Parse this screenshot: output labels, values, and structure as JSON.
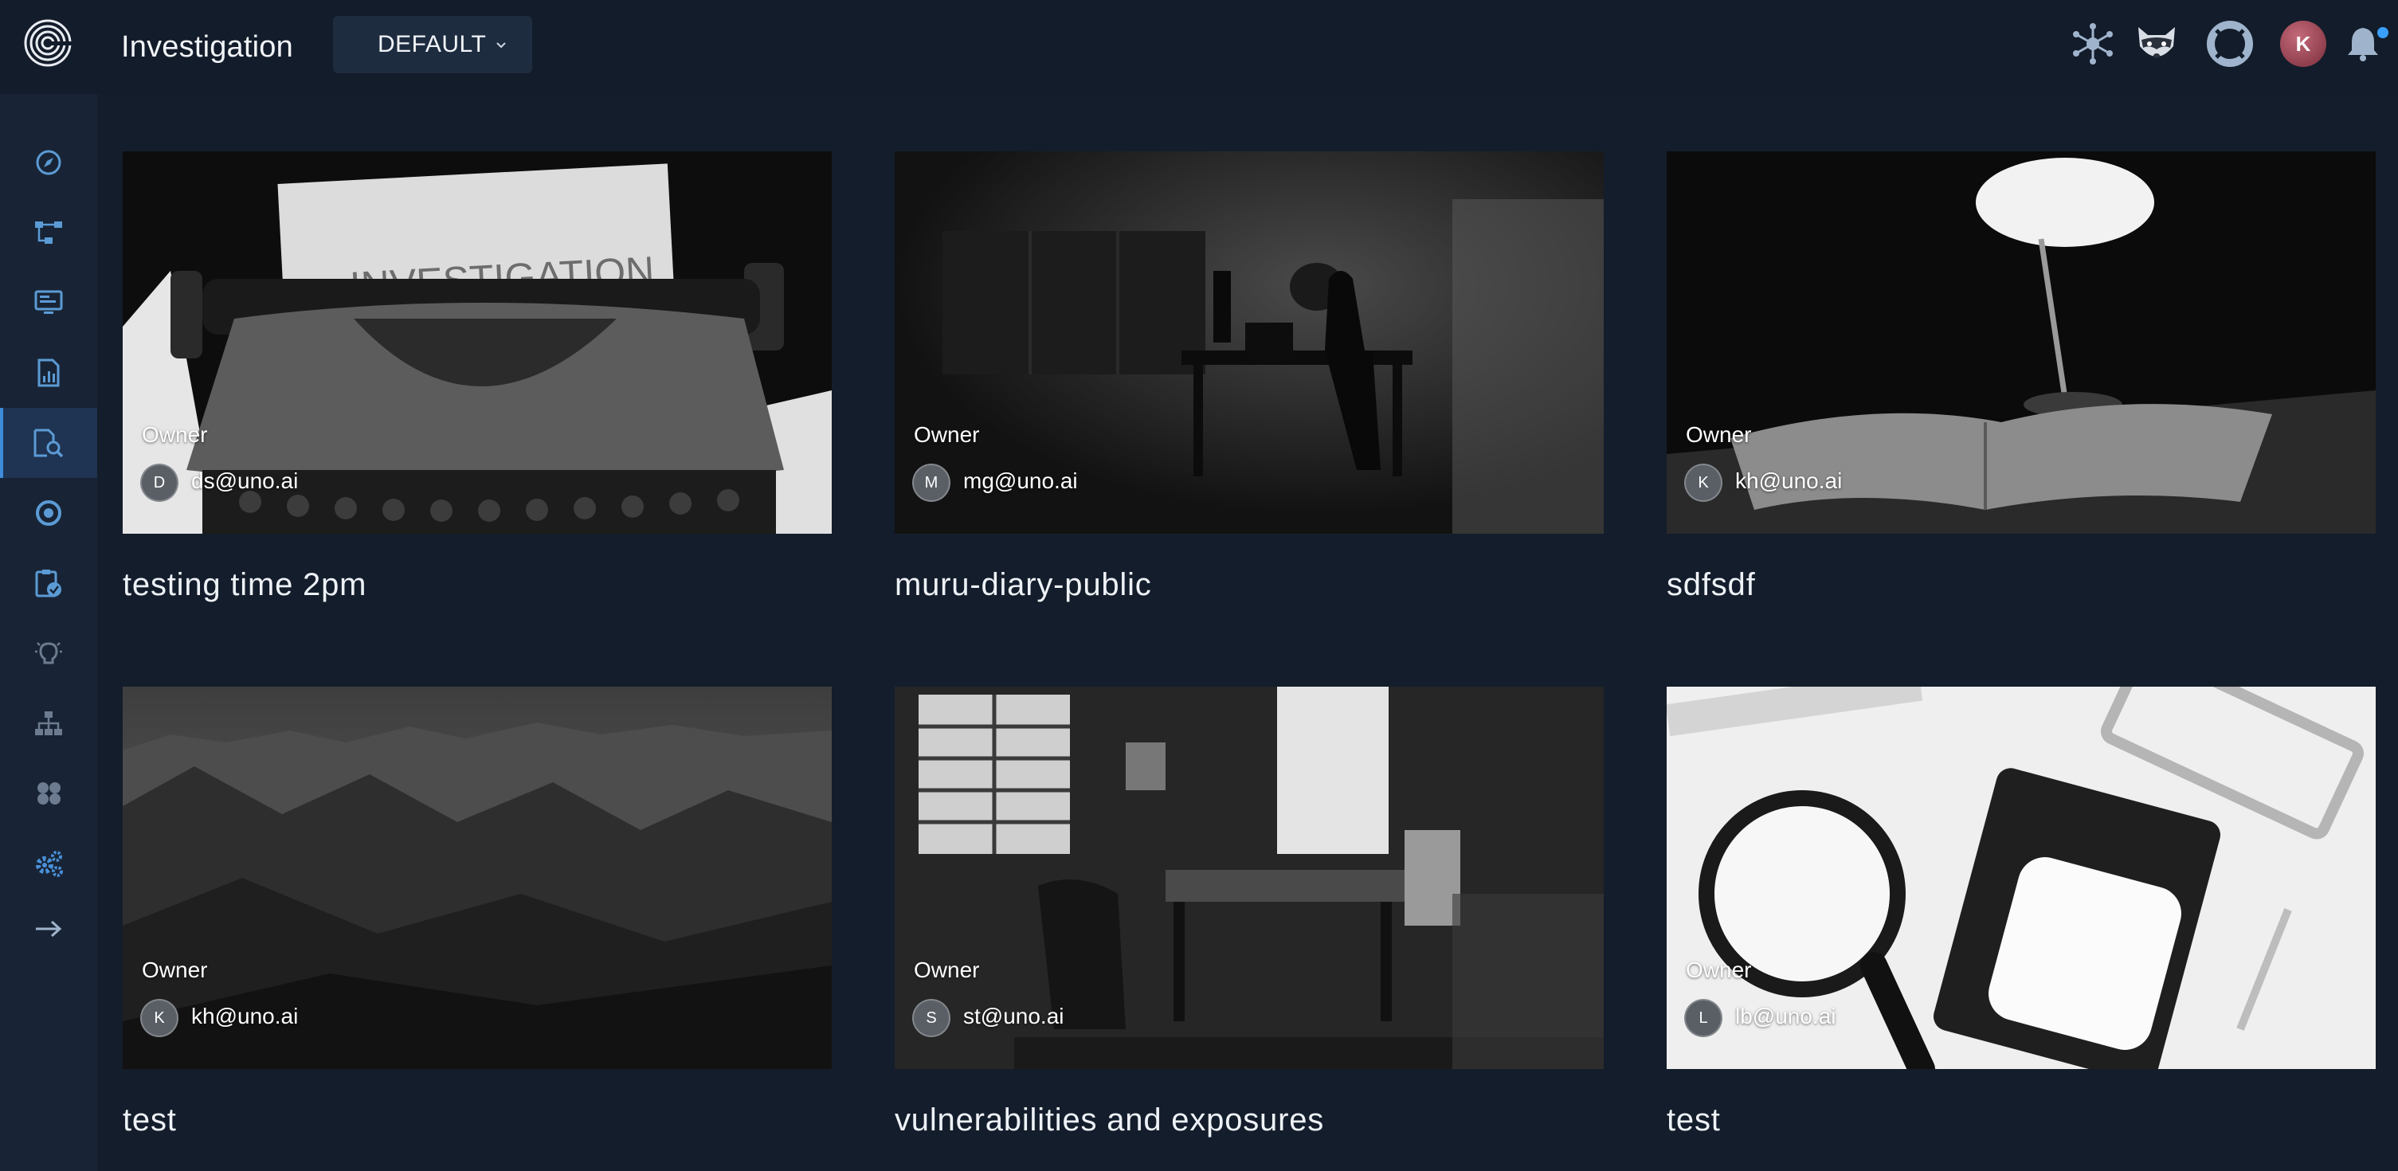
{
  "header": {
    "app_title": "Investigation",
    "workspace": {
      "selected": "DEFAULT"
    },
    "icons": [
      "graph-network-icon",
      "raccoon-mascot-icon",
      "help-lifebuoy-icon",
      "user-avatar",
      "bell-icon"
    ],
    "user_initial": "K"
  },
  "sidebar": {
    "items": [
      {
        "name": "compass-icon"
      },
      {
        "name": "workflow-icon"
      },
      {
        "name": "monitor-icon"
      },
      {
        "name": "report-icon"
      },
      {
        "name": "investigation-icon",
        "active": true
      },
      {
        "name": "threat-icon"
      },
      {
        "name": "clipboard-check-icon"
      },
      {
        "name": "lightbulb-icon"
      },
      {
        "name": "hierarchy-icon"
      },
      {
        "name": "cubes-icon"
      },
      {
        "name": "settings-gears-icon"
      },
      {
        "name": "expand-arrow-icon"
      }
    ]
  },
  "cards": [
    {
      "title": "testing time 2pm",
      "owner_label": "Owner",
      "owner_initial": "D",
      "owner_email": "ds@uno.ai",
      "image": "typewriter"
    },
    {
      "title": "muru-diary-public",
      "owner_label": "Owner",
      "owner_initial": "M",
      "owner_email": "mg@uno.ai",
      "image": "dark-room-desk"
    },
    {
      "title": "sdfsdf",
      "owner_label": "Owner",
      "owner_initial": "K",
      "owner_email": "kh@uno.ai",
      "image": "lamp-book"
    },
    {
      "title": "test",
      "owner_label": "Owner",
      "owner_initial": "K",
      "owner_email": "kh@uno.ai",
      "image": "mountains"
    },
    {
      "title": "vulnerabilities and exposures",
      "owner_label": "Owner",
      "owner_initial": "S",
      "owner_email": "st@uno.ai",
      "image": "office-room"
    },
    {
      "title": "test",
      "owner_label": "Owner",
      "owner_initial": "L",
      "owner_email": "lb@uno.ai",
      "image": "magnifier-notepad"
    }
  ],
  "colors": {
    "background": "#141d2b",
    "sidebar": "#182435",
    "accent": "#3d8bd9",
    "icon": "#5b9bd5"
  }
}
